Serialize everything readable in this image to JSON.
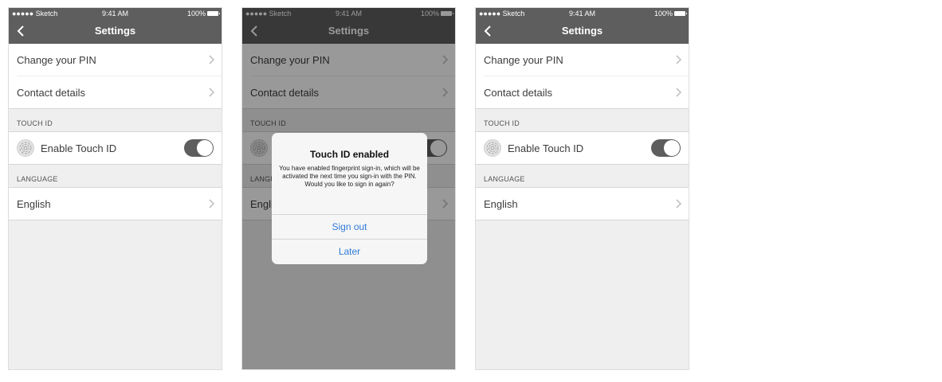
{
  "status": {
    "carrier": "●●●●● Sketch",
    "time": "9:41 AM",
    "battery": "100%"
  },
  "navbar": {
    "title": "Settings"
  },
  "rows": {
    "change_pin": "Change your PIN",
    "contact": "Contact details",
    "touch_section": "TOUCH ID",
    "touch_label": "Enable Touch ID",
    "language_section": "LANGUAGE",
    "language": "English"
  },
  "toggle": {
    "on": true
  },
  "dialog": {
    "title": "Touch ID enabled",
    "message": "You have enabled fingerprint sign-in, which will be activated the next time you sign-in with the PIN. Would you like to sign in again?",
    "sign_out": "Sign out",
    "later": "Later"
  },
  "colors": {
    "nav": "#5e5e5e",
    "accent": "#2f7ad8",
    "background": "#efefef"
  }
}
